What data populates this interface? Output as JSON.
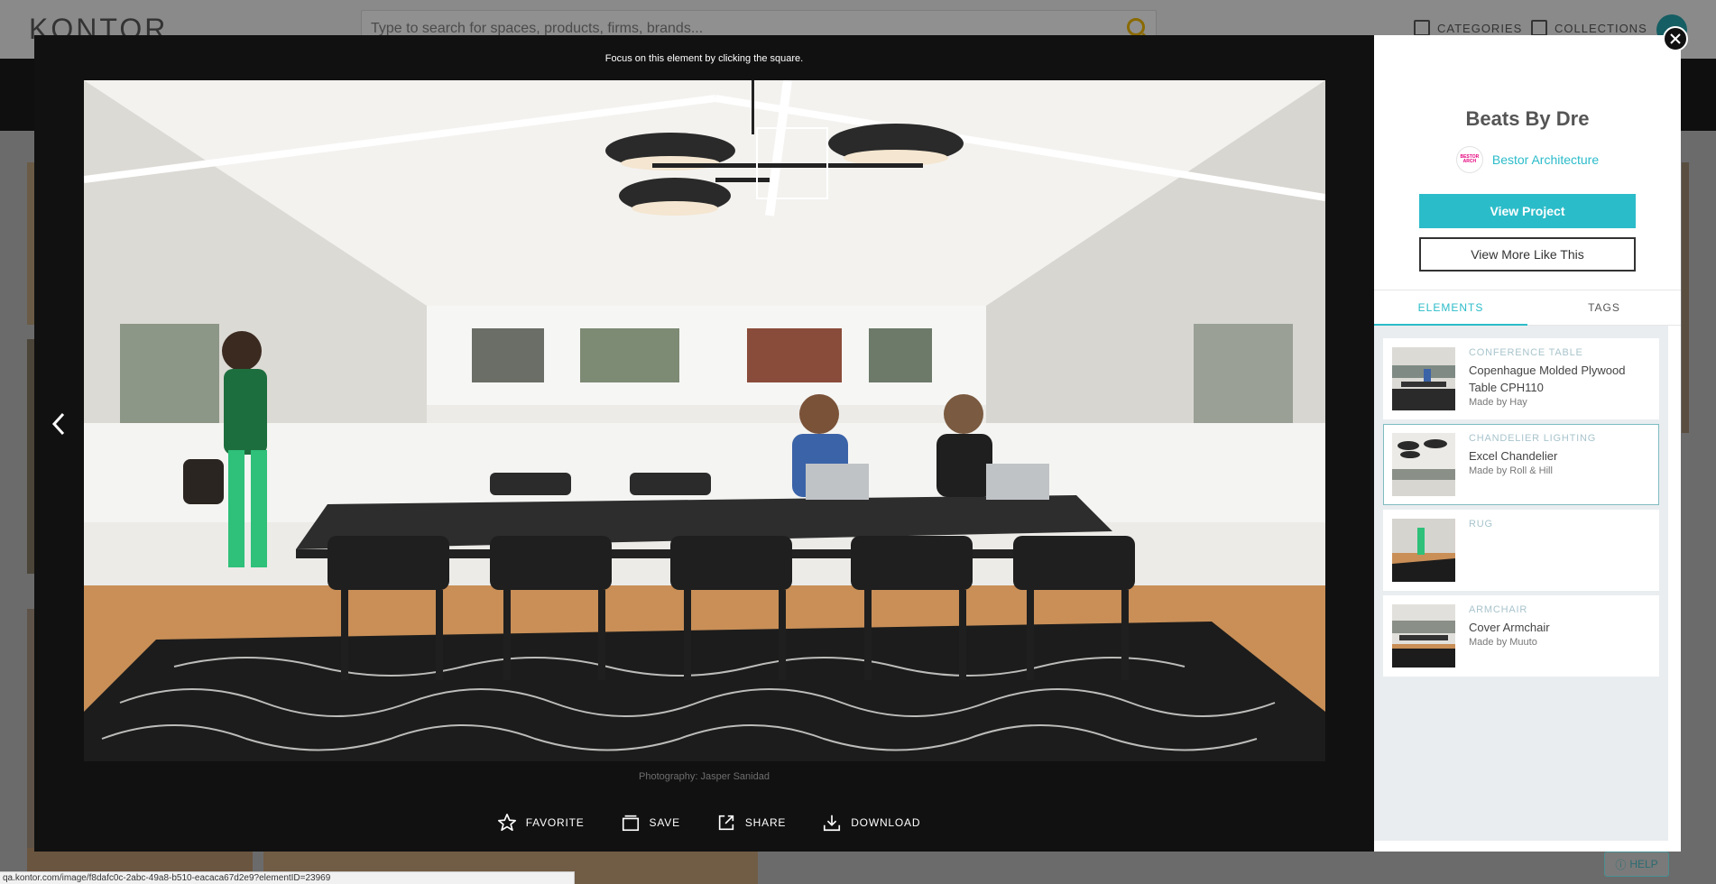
{
  "background": {
    "logo": "KONTOR",
    "search_placeholder": "Type to search for spaces, products, firms, brands...",
    "nav": {
      "categories": "CATEGORIES",
      "collections": "COLLECTIONS"
    },
    "help": "HELP"
  },
  "viewer": {
    "focus_hint": "Focus on this element by clicking the square.",
    "credit": "Photography: Jasper Sanidad",
    "actions": {
      "favorite": "FAVORITE",
      "save": "SAVE",
      "share": "SHARE",
      "download": "DOWNLOAD"
    }
  },
  "panel": {
    "title": "Beats By Dre",
    "firm_name": "Bestor Architecture",
    "view_project": "View Project",
    "view_more": "View More Like This",
    "tabs": [
      {
        "label": "ELEMENTS",
        "active": true
      },
      {
        "label": "TAGS",
        "active": false
      }
    ],
    "elements": [
      {
        "category": "CONFERENCE TABLE",
        "name": "Copenhague Molded Plywood Table CPH110",
        "maker": "Made by Hay"
      },
      {
        "category": "CHANDELIER LIGHTING",
        "name": "Excel Chandelier",
        "maker": "Made by Roll & Hill"
      },
      {
        "category": "RUG",
        "name": "",
        "maker": ""
      },
      {
        "category": "ARMCHAIR",
        "name": "Cover Armchair",
        "maker": "Made by Muuto"
      }
    ]
  },
  "status_url": "qa.kontor.com/image/f8dafc0c-2abc-49a8-b510-eacaca67d2e9?elementID=23969",
  "colors": {
    "accent": "#2bbcc9",
    "viewer_bg": "#111111"
  }
}
